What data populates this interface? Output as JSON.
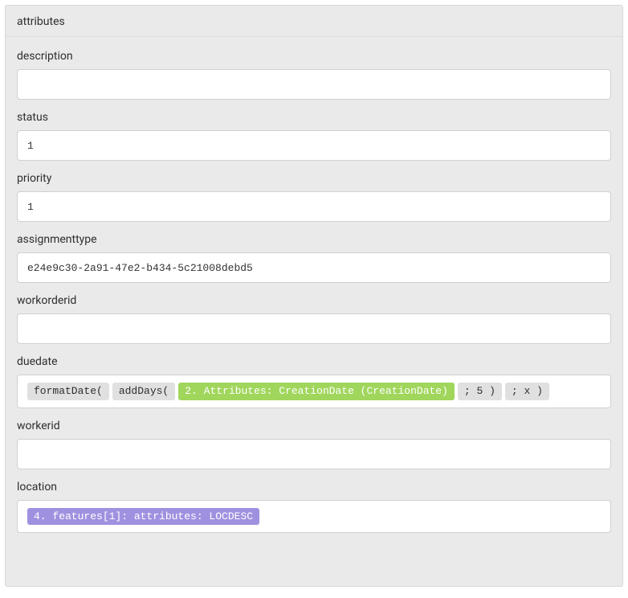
{
  "panel": {
    "title": "attributes"
  },
  "fields": {
    "description": {
      "label": "description",
      "value": ""
    },
    "status": {
      "label": "status",
      "value": "1"
    },
    "priority": {
      "label": "priority",
      "value": "1"
    },
    "assignmenttype": {
      "label": "assignmenttype",
      "value": "e24e9c30-2a91-47e2-b434-5c21008debd5"
    },
    "workorderid": {
      "label": "workorderid",
      "value": ""
    },
    "duedate": {
      "label": "duedate",
      "tokens": [
        {
          "type": "gray",
          "text": "formatDate("
        },
        {
          "type": "gray",
          "text": "addDays("
        },
        {
          "type": "green",
          "text": "2. Attributes: CreationDate (CreationDate)"
        },
        {
          "type": "gray",
          "text": "; 5 )"
        },
        {
          "type": "gray",
          "text": "; x )"
        }
      ]
    },
    "workerid": {
      "label": "workerid",
      "value": ""
    },
    "location": {
      "label": "location",
      "tokens": [
        {
          "type": "purple",
          "text": "4. features[1]: attributes: LOCDESC"
        }
      ]
    }
  }
}
